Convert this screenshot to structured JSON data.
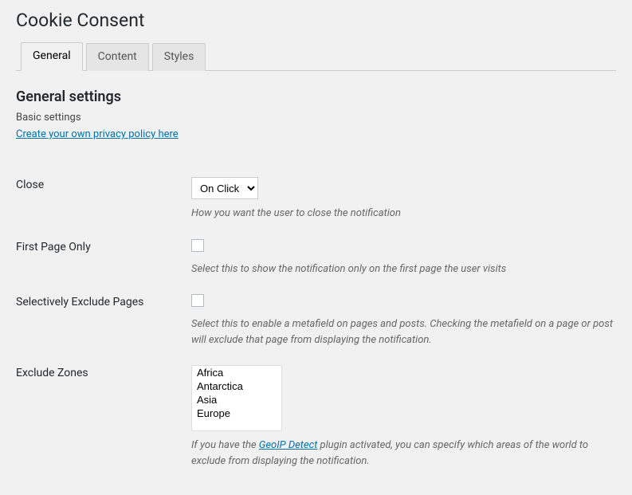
{
  "page": {
    "title": "Cookie Consent"
  },
  "tabs": [
    {
      "label": "General",
      "active": true
    },
    {
      "label": "Content",
      "active": false
    },
    {
      "label": "Styles",
      "active": false
    }
  ],
  "section": {
    "title": "General settings",
    "sub": "Basic settings",
    "policy_link": "Create your own privacy policy here"
  },
  "fields": {
    "close": {
      "label": "Close",
      "value": "On Click",
      "options": [
        "On Click"
      ],
      "desc": "How you want the user to close the notification"
    },
    "first_page": {
      "label": "First Page Only",
      "checked": false,
      "desc": "Select this to show the notification only on the first page the user visits"
    },
    "exclude_pages": {
      "label": "Selectively Exclude Pages",
      "checked": false,
      "desc": "Select this to enable a metafield on pages and posts. Checking the metafield on a page or post will exclude that page from displaying the notification."
    },
    "exclude_zones": {
      "label": "Exclude Zones",
      "options": [
        "Africa",
        "Antarctica",
        "Asia",
        "Europe"
      ],
      "desc_pre": "If you have the ",
      "desc_link": "GeoIP Detect",
      "desc_post": " plugin activated, you can specify which areas of the world to exclude from displaying the notification."
    }
  }
}
